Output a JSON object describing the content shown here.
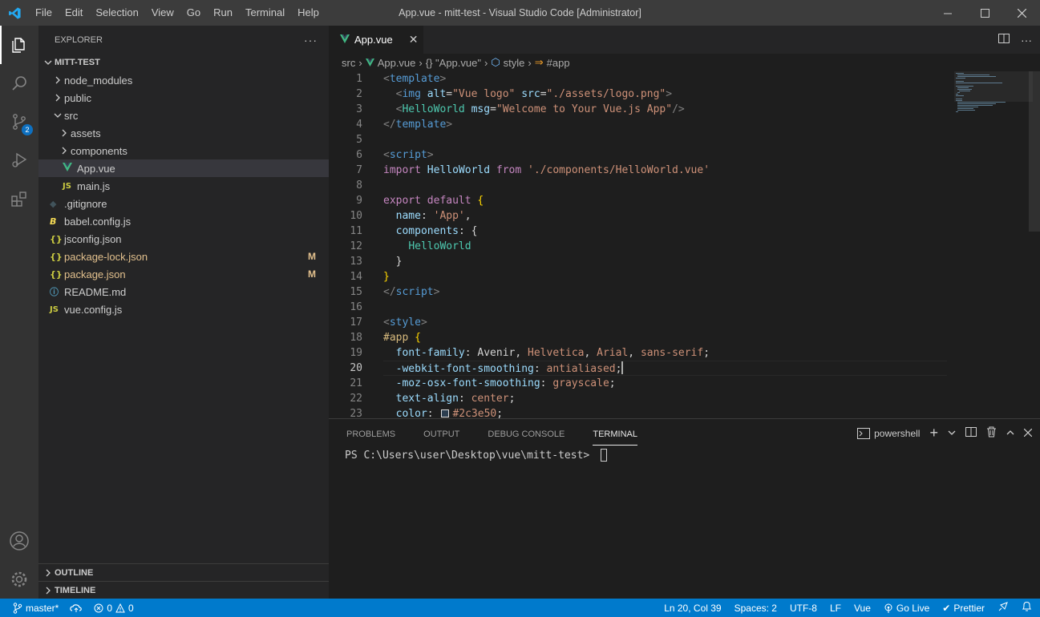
{
  "window": {
    "title": "App.vue - mitt-test - Visual Studio Code [Administrator]",
    "menu": [
      "File",
      "Edit",
      "Selection",
      "View",
      "Go",
      "Run",
      "Terminal",
      "Help"
    ]
  },
  "activity_bar": {
    "items": [
      "explorer-icon",
      "search-icon",
      "source-control-icon",
      "run-debug-icon",
      "extensions-icon"
    ],
    "source_control_badge": "2",
    "bottom_items": [
      "account-icon",
      "manage-gear-icon"
    ]
  },
  "sidebar": {
    "title": "EXPLORER",
    "more": "···",
    "root": "MITT-TEST",
    "tree": [
      {
        "label": "node_modules",
        "type": "folder",
        "indent": 1
      },
      {
        "label": "public",
        "type": "folder",
        "indent": 1
      },
      {
        "label": "src",
        "type": "folder-open",
        "indent": 1
      },
      {
        "label": "assets",
        "type": "folder",
        "indent": 2
      },
      {
        "label": "components",
        "type": "folder",
        "indent": 2
      },
      {
        "label": "App.vue",
        "type": "vue",
        "indent": 2
      },
      {
        "label": "main.js",
        "type": "js",
        "indent": 2
      },
      {
        "label": ".gitignore",
        "type": "git",
        "indent": 1
      },
      {
        "label": "babel.config.js",
        "type": "babel",
        "indent": 1
      },
      {
        "label": "jsconfig.json",
        "type": "json",
        "indent": 1
      },
      {
        "label": "package-lock.json",
        "type": "json",
        "indent": 1,
        "badge": "M"
      },
      {
        "label": "package.json",
        "type": "json",
        "indent": 1,
        "badge": "M"
      },
      {
        "label": "README.md",
        "type": "info",
        "indent": 1
      },
      {
        "label": "vue.config.js",
        "type": "js",
        "indent": 1
      }
    ],
    "outline": "OUTLINE",
    "timeline": "TIMELINE"
  },
  "editor": {
    "tab": {
      "label": "App.vue",
      "close": "✕"
    },
    "breadcrumbs": [
      "src",
      "App.vue",
      "{} \"App.vue\"",
      "style",
      "#app"
    ],
    "current_line": 20,
    "lines": [
      [
        [
          "t-tag",
          "<"
        ],
        [
          "t-tn",
          "template"
        ],
        [
          "t-tag",
          ">"
        ]
      ],
      [
        [
          "t-w",
          "  "
        ],
        [
          "t-tag",
          "<"
        ],
        [
          "t-tn",
          "img"
        ],
        [
          "t-w",
          " "
        ],
        [
          "t-attr",
          "alt"
        ],
        [
          "t-w",
          "="
        ],
        [
          "t-str",
          "\"Vue logo\""
        ],
        [
          "t-w",
          " "
        ],
        [
          "t-attr",
          "src"
        ],
        [
          "t-w",
          "="
        ],
        [
          "t-str",
          "\"./assets/logo.png\""
        ],
        [
          "t-tag",
          ">"
        ]
      ],
      [
        [
          "t-w",
          "  "
        ],
        [
          "t-tag",
          "<"
        ],
        [
          "t-cmp",
          "HelloWorld"
        ],
        [
          "t-w",
          " "
        ],
        [
          "t-attr",
          "msg"
        ],
        [
          "t-w",
          "="
        ],
        [
          "t-str",
          "\"Welcome to Your Vue.js App\""
        ],
        [
          "t-tag",
          "/>"
        ]
      ],
      [
        [
          "t-tag",
          "</"
        ],
        [
          "t-tn",
          "template"
        ],
        [
          "t-tag",
          ">"
        ]
      ],
      [],
      [
        [
          "t-tag",
          "<"
        ],
        [
          "t-tn",
          "script"
        ],
        [
          "t-tag",
          ">"
        ]
      ],
      [
        [
          "t-kw",
          "import"
        ],
        [
          "t-w",
          " "
        ],
        [
          "t-id",
          "HelloWorld"
        ],
        [
          "t-w",
          " "
        ],
        [
          "t-kw",
          "from"
        ],
        [
          "t-w",
          " "
        ],
        [
          "t-str",
          "'./components/HelloWorld.vue'"
        ]
      ],
      [],
      [
        [
          "t-kw",
          "export"
        ],
        [
          "t-w",
          " "
        ],
        [
          "t-kw",
          "default"
        ],
        [
          "t-w",
          " "
        ],
        [
          "t-brb",
          "{"
        ]
      ],
      [
        [
          "t-w",
          "  "
        ],
        [
          "t-id",
          "name"
        ],
        [
          "t-w",
          ": "
        ],
        [
          "t-str",
          "'App'"
        ],
        [
          "t-w",
          ","
        ]
      ],
      [
        [
          "t-w",
          "  "
        ],
        [
          "t-id",
          "components"
        ],
        [
          "t-w",
          ": "
        ],
        [
          "t-br",
          "{"
        ]
      ],
      [
        [
          "t-w",
          "    "
        ],
        [
          "t-cls",
          "HelloWorld"
        ]
      ],
      [
        [
          "t-w",
          "  "
        ],
        [
          "t-br",
          "}"
        ]
      ],
      [
        [
          "t-brb",
          "}"
        ]
      ],
      [
        [
          "t-tag",
          "</"
        ],
        [
          "t-tn",
          "script"
        ],
        [
          "t-tag",
          ">"
        ]
      ],
      [],
      [
        [
          "t-tag",
          "<"
        ],
        [
          "t-tn",
          "style"
        ],
        [
          "t-tag",
          ">"
        ]
      ],
      [
        [
          "t-sel",
          "#app"
        ],
        [
          "t-w",
          " "
        ],
        [
          "t-brb",
          "{"
        ]
      ],
      [
        [
          "t-w",
          "  "
        ],
        [
          "t-id",
          "font-family"
        ],
        [
          "t-w",
          ": "
        ],
        [
          "t-w",
          "Avenir"
        ],
        [
          "t-w",
          ", "
        ],
        [
          "t-str",
          "Helvetica"
        ],
        [
          "t-w",
          ", "
        ],
        [
          "t-str",
          "Arial"
        ],
        [
          "t-w",
          ", "
        ],
        [
          "t-str",
          "sans-serif"
        ],
        [
          "t-w",
          ";"
        ]
      ],
      [
        [
          "t-w",
          "  "
        ],
        [
          "t-id",
          "-webkit-font-smoothing"
        ],
        [
          "t-w",
          ": "
        ],
        [
          "t-str",
          "antialiased"
        ],
        [
          "t-w",
          ";"
        ]
      ],
      [
        [
          "t-w",
          "  "
        ],
        [
          "t-id",
          "-moz-osx-font-smoothing"
        ],
        [
          "t-w",
          ": "
        ],
        [
          "t-str",
          "grayscale"
        ],
        [
          "t-w",
          ";"
        ]
      ],
      [
        [
          "t-w",
          "  "
        ],
        [
          "t-id",
          "text-align"
        ],
        [
          "t-w",
          ": "
        ],
        [
          "t-str",
          "center"
        ],
        [
          "t-w",
          ";"
        ]
      ],
      [
        [
          "t-w",
          "  "
        ],
        [
          "t-id",
          "color"
        ],
        [
          "t-w",
          ": "
        ],
        [
          "swatch",
          ""
        ],
        [
          "t-str",
          "#2c3e50"
        ],
        [
          "t-w",
          ";"
        ]
      ]
    ]
  },
  "panel": {
    "tabs": [
      "PROBLEMS",
      "OUTPUT",
      "DEBUG CONSOLE",
      "TERMINAL"
    ],
    "active_tab": "TERMINAL",
    "shell": "powershell",
    "prompt": "PS C:\\Users\\user\\Desktop\\vue\\mitt-test> "
  },
  "statusbar": {
    "branch": "master*",
    "errors": "0",
    "warnings": "0",
    "position": "Ln 20, Col 39",
    "spaces": "Spaces: 2",
    "encoding": "UTF-8",
    "eol": "LF",
    "language": "Vue",
    "golive": "Go Live",
    "prettier": "Prettier"
  },
  "colors": {
    "accent": "#007acc",
    "vue_green": "#41b883",
    "js_yellow": "#cbcb41",
    "modified": "#e2c08d"
  }
}
